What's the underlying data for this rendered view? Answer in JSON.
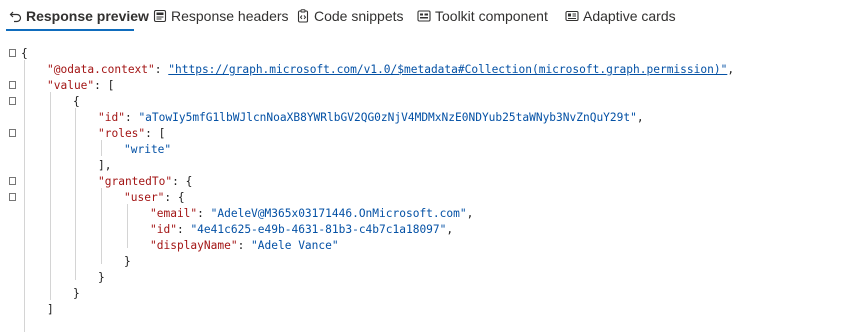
{
  "tabs": [
    {
      "label": "Response preview",
      "icon": "undo-arrow-icon",
      "active": true
    },
    {
      "label": "Response headers",
      "icon": "document-header-icon",
      "active": false
    },
    {
      "label": "Code snippets",
      "icon": "clipboard-code-icon",
      "active": false
    },
    {
      "label": "Toolkit component",
      "icon": "toolkit-component-icon",
      "active": false
    },
    {
      "label": "Adaptive cards",
      "icon": "adaptive-card-icon",
      "active": false
    }
  ],
  "colors": {
    "accent": "#0f6cbd",
    "json_key": "#a31515",
    "json_string": "#0451a5",
    "punctuation": "#1f1f1f"
  },
  "json_text": {
    "open_root": "{",
    "context_key": "\"@odata.context\"",
    "context_value": "\"https://graph.microsoft.com/v1.0/$metadata#Collection(microsoft.graph.permission)\"",
    "value_key": "\"value\"",
    "open_array": "[",
    "open_obj": "{",
    "id_key": "\"id\"",
    "id_value": "\"aTowIy5mfG1lbWJlcnNoaXB8YWRlbGV2QG0zNjV4MDMxNzE0NDYub25taWNyb3NvZnQuY29t\"",
    "roles_key": "\"roles\"",
    "roles_open": "[",
    "role_write": "\"write\"",
    "roles_close": "],",
    "granted_key": "\"grantedTo\"",
    "granted_open": "{",
    "user_key": "\"user\"",
    "user_open": "{",
    "email_key": "\"email\"",
    "email_value": "\"AdeleV@M365x03171446.OnMicrosoft.com\"",
    "uid_key": "\"id\"",
    "uid_value": "\"4e41c625-e49b-4631-81b3-c4b7c1a18097\"",
    "name_key": "\"displayName\"",
    "name_value": "\"Adele Vance\"",
    "close_user": "}",
    "close_granted": "}",
    "close_obj": "}",
    "close_array": "]"
  }
}
